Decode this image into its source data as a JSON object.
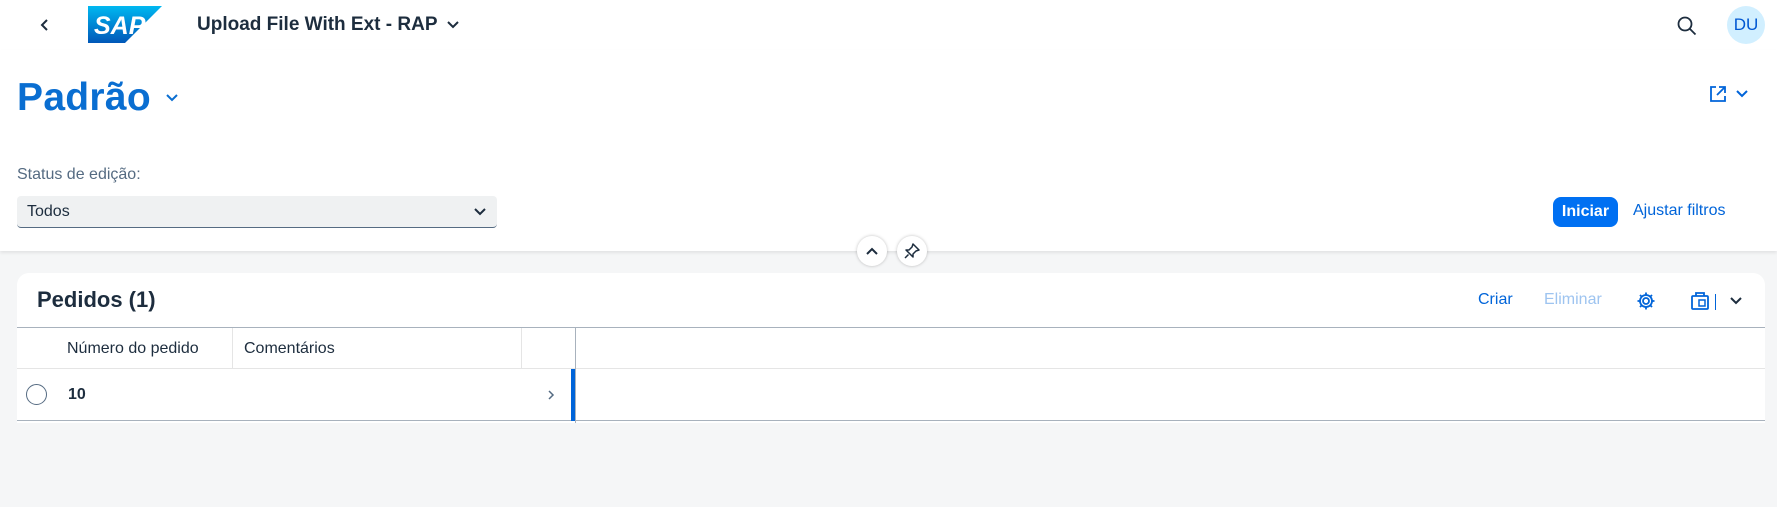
{
  "shell": {
    "logo_text": "SAP",
    "app_title": "Upload File With Ext - RAP",
    "avatar_initials": "DU"
  },
  "header": {
    "variant_title": "Padrão",
    "filter_label": "Status de edição:",
    "filter_value": "Todos",
    "go_label": "Iniciar",
    "adapt_label": "Ajustar filtros"
  },
  "table": {
    "title": "Pedidos (1)",
    "create_label": "Criar",
    "delete_label": "Eliminar",
    "columns": [
      "Número do pedido",
      "Comentários"
    ],
    "rows": [
      {
        "order_number": "10",
        "comments": ""
      }
    ]
  },
  "colors": {
    "brand": "#0a6ed1",
    "accent": "#0070f2",
    "link": "#0064d9"
  }
}
